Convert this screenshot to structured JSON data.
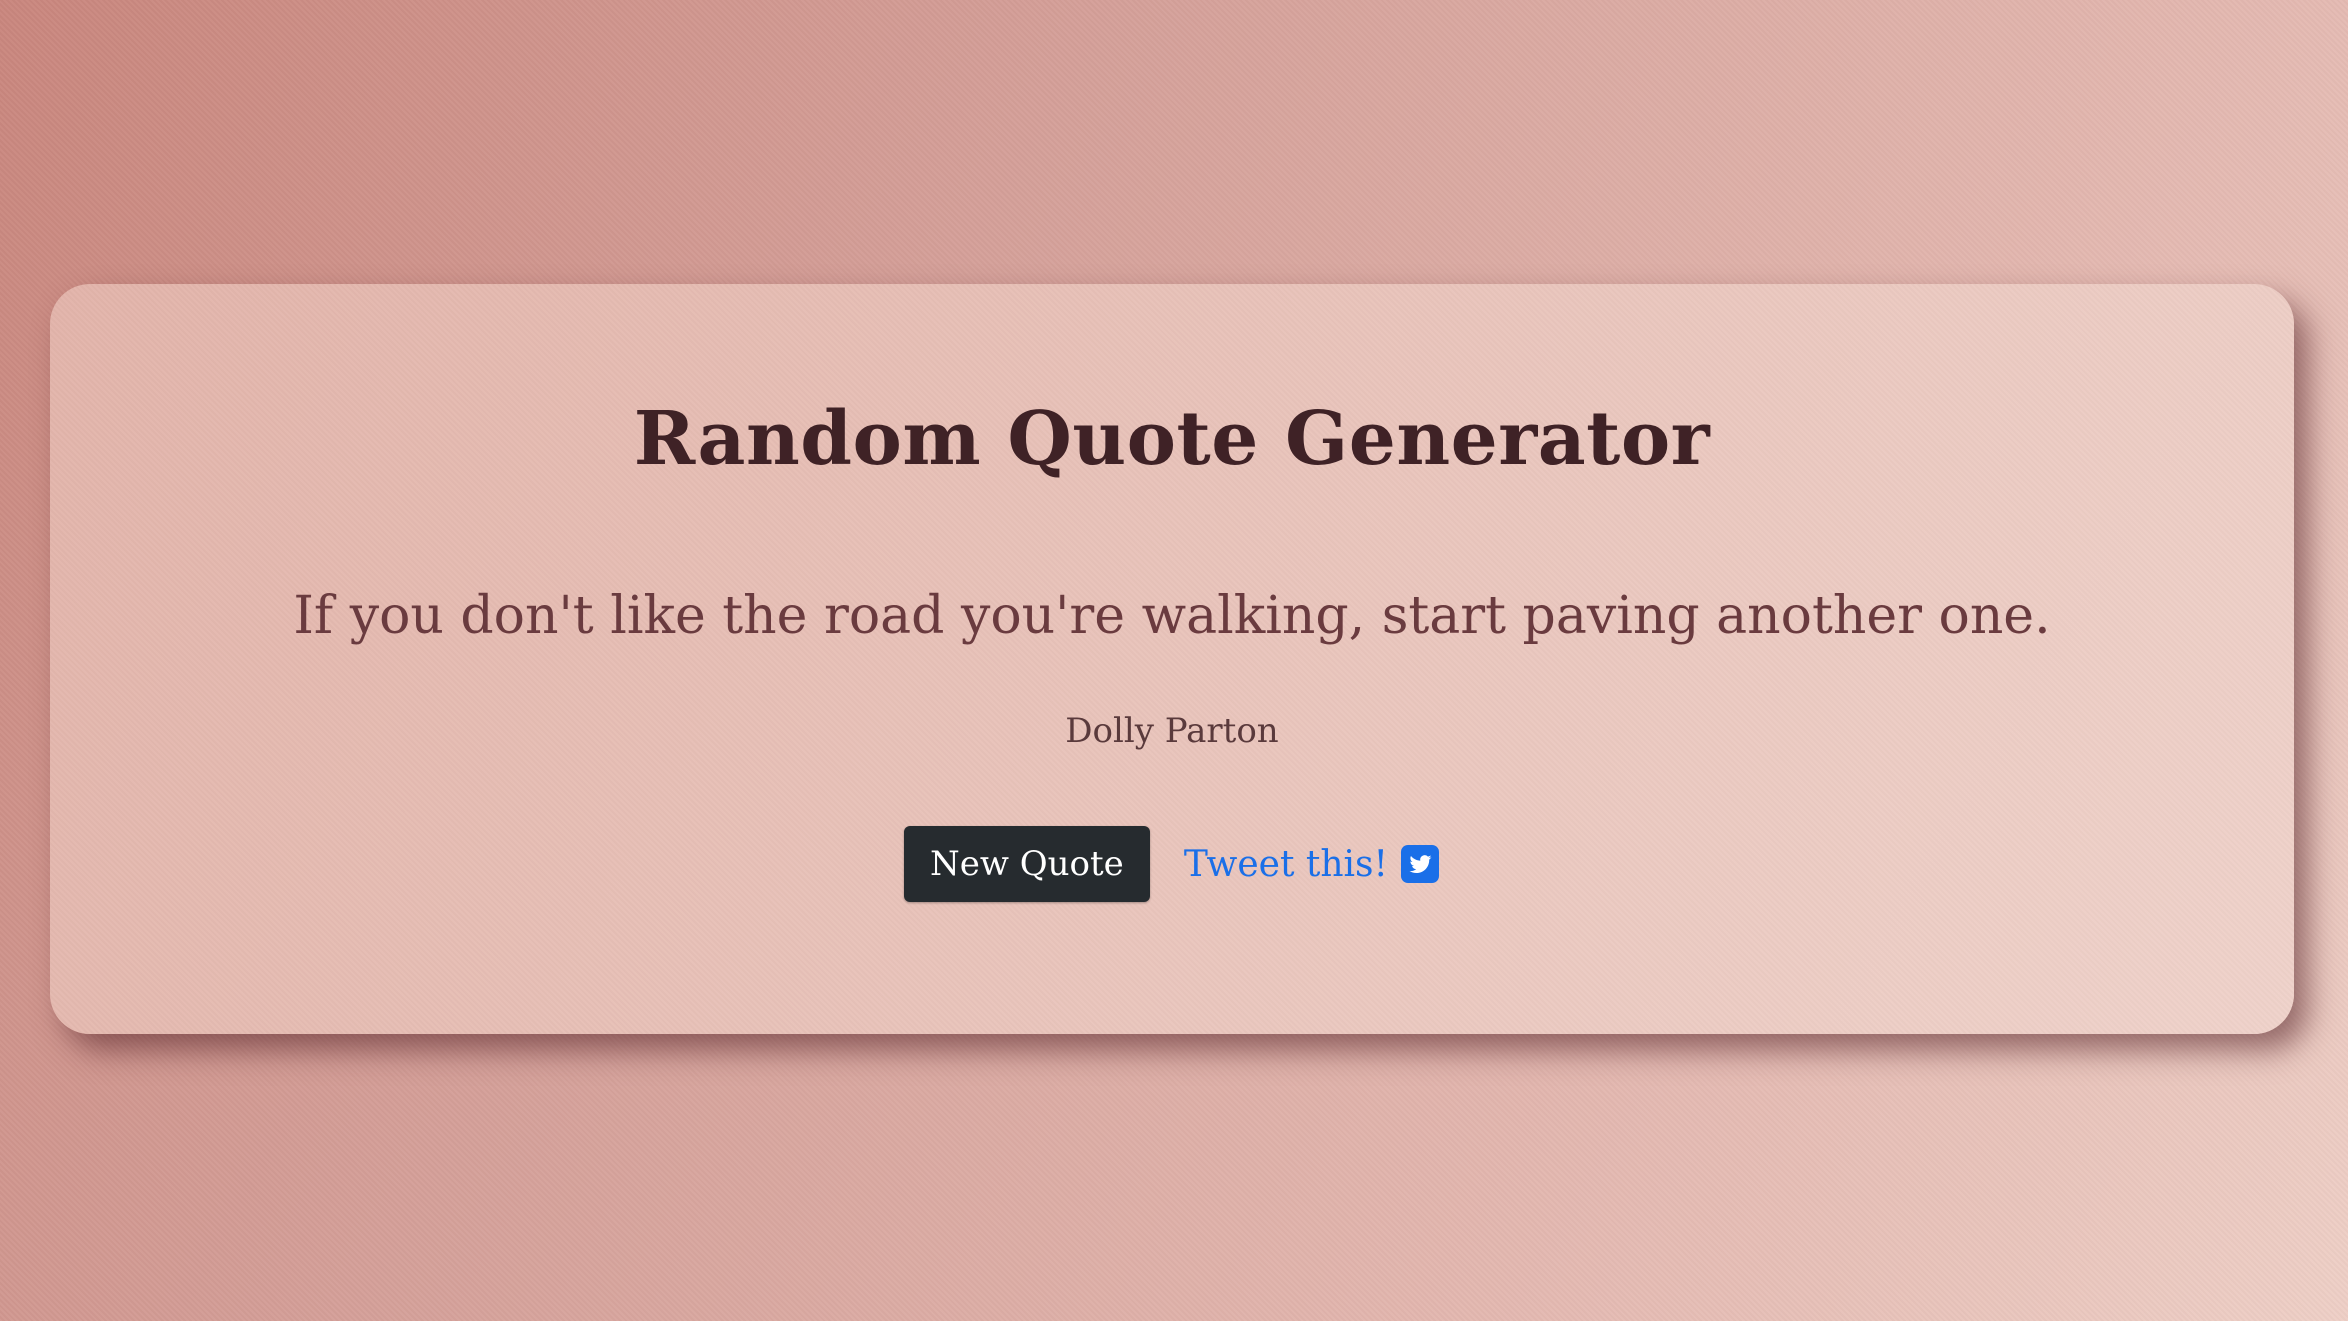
{
  "app": {
    "title": "Random Quote Generator"
  },
  "quote": {
    "text": "If you don't like the road you're walking, start paving another one.",
    "author": "Dolly Parton"
  },
  "actions": {
    "new_quote_label": "New Quote",
    "tweet_label": "Tweet this!",
    "tweet_icon": "twitter-square-icon"
  },
  "colors": {
    "title": "#3f2226",
    "quote": "#6a3b3f",
    "button_bg": "#262b2f",
    "link": "#1a6fe8"
  }
}
